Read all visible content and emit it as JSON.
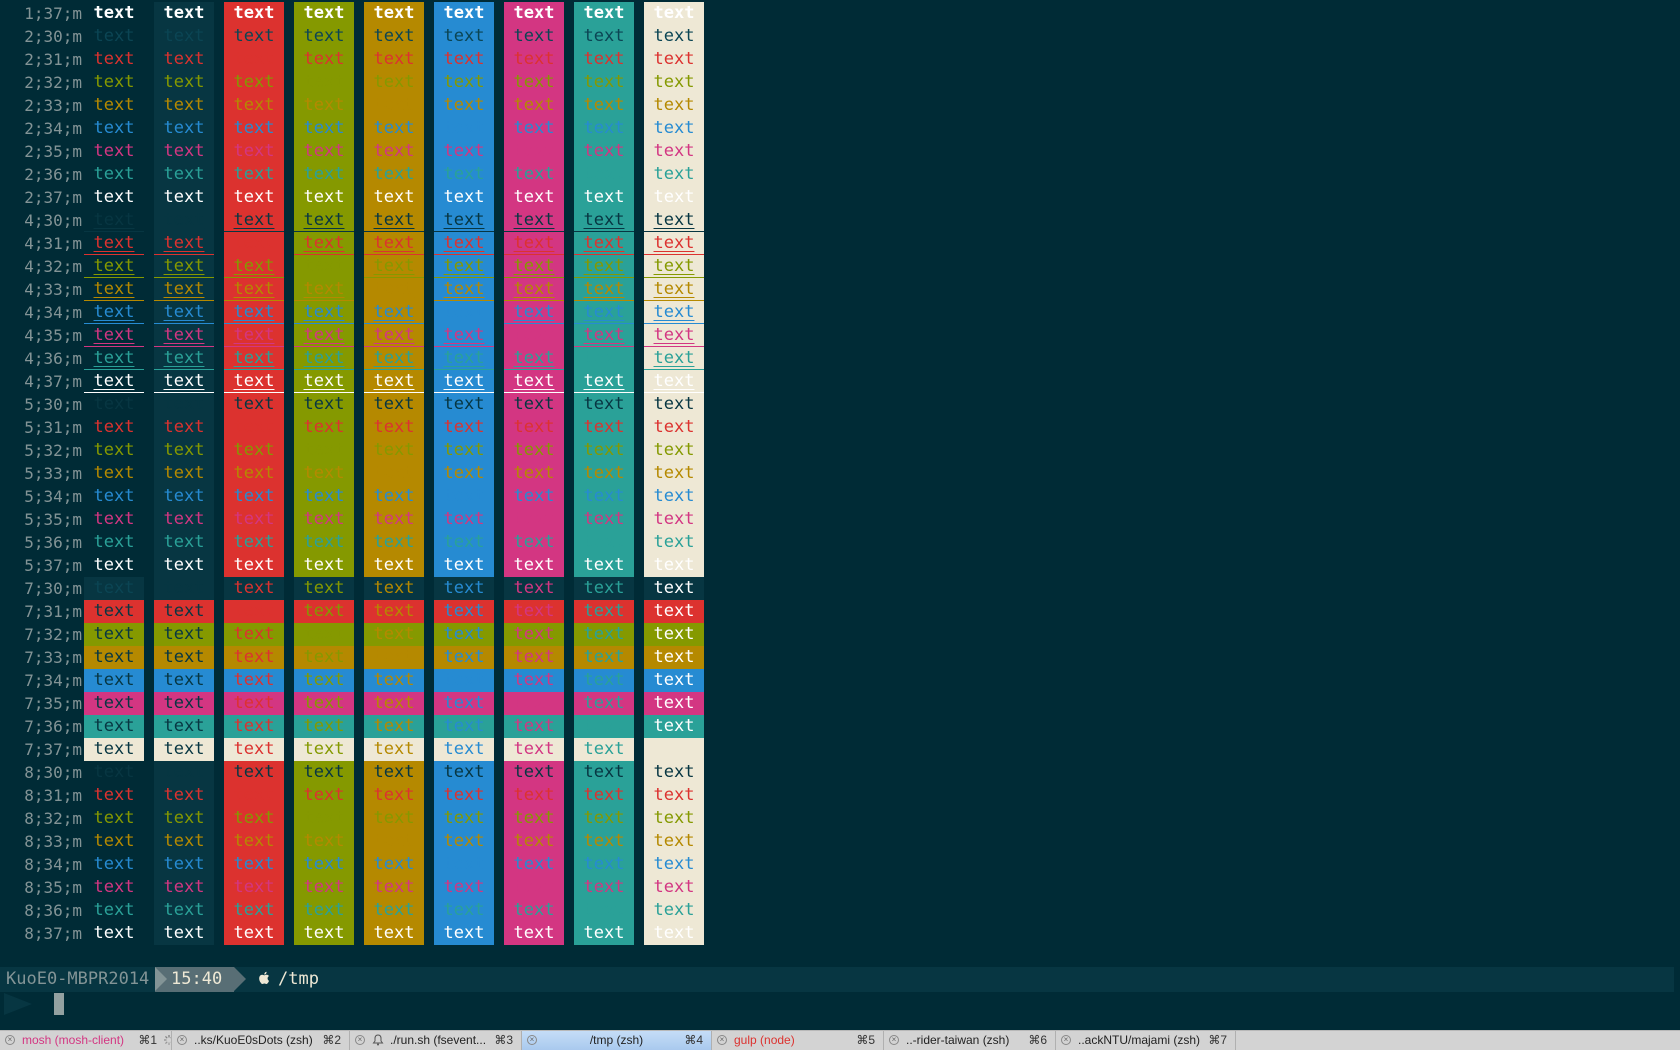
{
  "colors": {
    "background": "#002b36",
    "bg_alt": "#073642",
    "code_label": "#839496",
    "palette": {
      "30": "#073642",
      "31": "#dc322f",
      "32": "#859900",
      "33": "#b58900",
      "34": "#268bd2",
      "35": "#d33682",
      "36": "#2aa198",
      "37": "#eee8d5"
    },
    "bright_text": "#ffffff"
  },
  "grid": {
    "cell_text": "text",
    "bg_columns": [
      "none",
      "40",
      "41",
      "42",
      "43",
      "44",
      "45",
      "46",
      "47"
    ],
    "rows": [
      "1;37;m",
      "2;30;m",
      "2;31;m",
      "2;32;m",
      "2;33;m",
      "2;34;m",
      "2;35;m",
      "2;36;m",
      "2;37;m",
      "4;30;m",
      "4;31;m",
      "4;32;m",
      "4;33;m",
      "4;34;m",
      "4;35;m",
      "4;36;m",
      "4;37;m",
      "5;30;m",
      "5;31;m",
      "5;32;m",
      "5;33;m",
      "5;34;m",
      "5;35;m",
      "5;36;m",
      "5;37;m",
      "7;30;m",
      "7;31;m",
      "7;32;m",
      "7;33;m",
      "7;34;m",
      "7;35;m",
      "7;36;m",
      "7;37;m",
      "8;30;m",
      "8;31;m",
      "8;32;m",
      "8;33;m",
      "8;34;m",
      "8;35;m",
      "8;36;m",
      "8;37;m"
    ]
  },
  "prompt": {
    "host": "KuoE0-MBPR2014",
    "time": "15:40",
    "path": "/tmp",
    "path_icon": "apple-icon",
    "host_color": "#839496",
    "time_bg": "#586e75"
  },
  "tabs": [
    {
      "title": "mosh (mosh-client)",
      "shortcut": "⌘1",
      "active": false,
      "title_color": "#d33682",
      "icon": "close-icon",
      "activity": "spinner-icon"
    },
    {
      "title": "..ks/KuoE0sDots (zsh)",
      "shortcut": "⌘2",
      "active": false,
      "title_color": "#222222",
      "icon": "close-icon"
    },
    {
      "title": "./run.sh (fsevent...",
      "shortcut": "⌘3",
      "active": false,
      "title_color": "#222222",
      "icon": "close-icon",
      "activity": "bell-icon"
    },
    {
      "title": "/tmp (zsh)",
      "shortcut": "⌘4",
      "active": true,
      "title_color": "#222222",
      "icon": "close-icon"
    },
    {
      "title": "gulp (node)",
      "shortcut": "⌘5",
      "active": false,
      "title_color": "#dc322f",
      "icon": "close-icon"
    },
    {
      "title": "..-rider-taiwan (zsh)",
      "shortcut": "⌘6",
      "active": false,
      "title_color": "#222222",
      "icon": "close-icon"
    },
    {
      "title": "..ackNTU/majami (zsh)",
      "shortcut": "⌘7",
      "active": false,
      "title_color": "#222222",
      "icon": "close-icon"
    }
  ]
}
